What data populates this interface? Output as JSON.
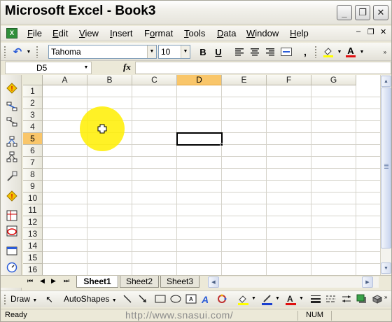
{
  "window": {
    "title": "Microsoft Excel - Book3",
    "buttons": {
      "minimize": "_",
      "restore": "❐",
      "close": "✕"
    }
  },
  "menu": {
    "items": [
      {
        "label": "File",
        "key": "F",
        "rest": "ile"
      },
      {
        "label": "Edit",
        "key": "E",
        "rest": "dit"
      },
      {
        "label": "View",
        "key": "V",
        "rest": "iew"
      },
      {
        "label": "Insert",
        "key": "I",
        "rest": "nsert"
      },
      {
        "label": "Format",
        "key": "o",
        "pre": "F",
        "rest": "rmat"
      },
      {
        "label": "Tools",
        "key": "T",
        "rest": "ools"
      },
      {
        "label": "Data",
        "key": "D",
        "rest": "ata"
      },
      {
        "label": "Window",
        "key": "W",
        "rest": "indow"
      },
      {
        "label": "Help",
        "key": "H",
        "rest": "elp"
      }
    ],
    "doc_controls": {
      "minimize": "–",
      "restore": "❐",
      "close": "✕"
    }
  },
  "toolbar": {
    "font_name": "Tahoma",
    "font_size": "10",
    "bold": "B",
    "underline": "U",
    "comma": ","
  },
  "formula_bar": {
    "name_box": "D5",
    "fx": "fx",
    "value": ""
  },
  "grid": {
    "columns": [
      "A",
      "B",
      "C",
      "D",
      "E",
      "F",
      "G"
    ],
    "rows": [
      "1",
      "2",
      "3",
      "4",
      "5",
      "6",
      "7",
      "8",
      "9",
      "10",
      "11",
      "12",
      "13",
      "14",
      "15",
      "16"
    ],
    "active_column": "D",
    "active_row": "5"
  },
  "sheets": {
    "tabs": [
      "Sheet1",
      "Sheet2",
      "Sheet3"
    ],
    "active": "Sheet1"
  },
  "drawing": {
    "draw": "Draw",
    "autoshapes": "AutoShapes"
  },
  "status": {
    "ready": "Ready",
    "watermark": "http://www.snasui.com/",
    "num": "NUM"
  }
}
